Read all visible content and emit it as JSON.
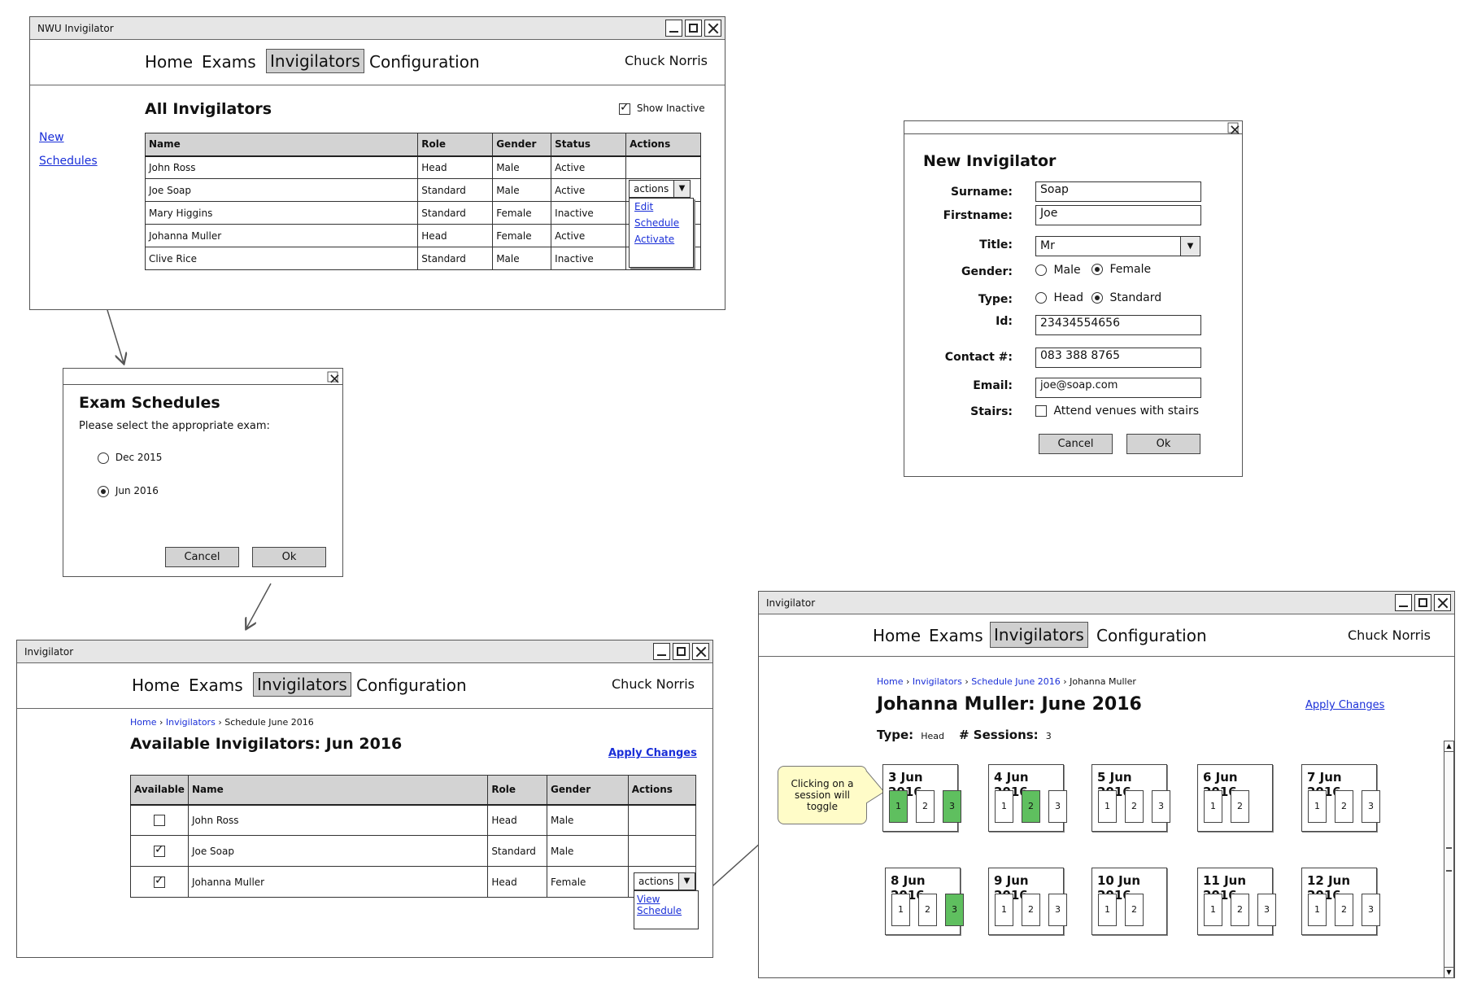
{
  "colors": {
    "link": "#1a2fd8",
    "active_session": "#5fbf5f",
    "header_bg": "#d3d3d3",
    "note_bg": "#fffcc8"
  },
  "nav": {
    "home": "Home",
    "exams": "Exams",
    "invigilators": "Invigilators",
    "configuration": "Configuration",
    "user": "Chuck Norris"
  },
  "w1": {
    "title": "NWU Invigilator",
    "heading": "All Invigilators",
    "show_inactive": "Show Inactive",
    "sidebar": [
      "New",
      "Schedules"
    ],
    "columns": [
      "Name",
      "Role",
      "Gender",
      "Status",
      "Actions"
    ],
    "rows": [
      [
        "John Ross",
        "Head",
        "Male",
        "Active"
      ],
      [
        "Joe Soap",
        "Standard",
        "Male",
        "Active"
      ],
      [
        "Mary Higgins",
        "Standard",
        "Female",
        "Inactive"
      ],
      [
        "Johanna Muller",
        "Head",
        "Female",
        "Active"
      ],
      [
        "Clive Rice",
        "Standard",
        "Male",
        "Inactive"
      ]
    ],
    "actions_label": "actions",
    "menu": [
      "Edit",
      "Schedule",
      "Activate"
    ]
  },
  "w2": {
    "heading": "Exam Schedules",
    "prompt": "Please select the appropriate exam:",
    "options": [
      "Dec 2015",
      "Jun 2016"
    ],
    "selected": "Jun 2016",
    "cancel": "Cancel",
    "ok": "Ok"
  },
  "w3": {
    "heading": "New Invigilator",
    "labels": {
      "surname": "Surname:",
      "firstname": "Firstname:",
      "title": "Title:",
      "gender": "Gender:",
      "type": "Type:",
      "id": "Id:",
      "contact": "Contact #:",
      "email": "Email:",
      "stairs": "Stairs:"
    },
    "values": {
      "surname": "Soap",
      "firstname": "Joe",
      "title": "Mr",
      "id": "23434554656",
      "contact": "083 388 8765",
      "email": "joe@soap.com"
    },
    "gender_options": [
      "Male",
      "Female"
    ],
    "gender_selected": "Female",
    "type_options": [
      "Head",
      "Standard"
    ],
    "type_selected": "Standard",
    "stairs_label": "Attend venues with stairs",
    "stairs_checked": false,
    "cancel": "Cancel",
    "ok": "Ok"
  },
  "w4": {
    "title": "Invigilator",
    "breadcrumb": [
      "Home",
      "Invigilators",
      "Schedule June 2016"
    ],
    "heading": "Available Invigilators: Jun 2016",
    "apply": "Apply Changes",
    "columns": [
      "Available",
      "Name",
      "Role",
      "Gender",
      "Actions"
    ],
    "rows": [
      {
        "available": false,
        "name": "John Ross",
        "role": "Head",
        "gender": "Male"
      },
      {
        "available": true,
        "name": "Joe Soap",
        "role": "Standard",
        "gender": "Male"
      },
      {
        "available": true,
        "name": "Johanna Muller",
        "role": "Head",
        "gender": "Female"
      }
    ],
    "actions_label": "actions",
    "menu": [
      "View Schedule"
    ]
  },
  "w5": {
    "title": "Invigilator",
    "breadcrumb": [
      "Home",
      "Invigilators",
      "Schedule June 2016",
      "Johanna Muller"
    ],
    "heading": "Johanna Muller: June 2016",
    "apply": "Apply Changes",
    "type_label": "Type:",
    "type_value": "Head",
    "sessions_label": "# Sessions:",
    "sessions_value": "3",
    "note": "Clicking on a session will toggle",
    "days": [
      {
        "date": "3 Jun 2016",
        "sessions": [
          "1",
          "2",
          "3"
        ],
        "active": [
          true,
          false,
          true
        ]
      },
      {
        "date": "4 Jun 2016",
        "sessions": [
          "1",
          "2",
          "3"
        ],
        "active": [
          false,
          true,
          false
        ]
      },
      {
        "date": "5 Jun 2016",
        "sessions": [
          "1",
          "2",
          "3"
        ],
        "active": [
          false,
          false,
          false
        ]
      },
      {
        "date": "6 Jun 2016",
        "sessions": [
          "1",
          "2"
        ],
        "active": [
          false,
          false
        ]
      },
      {
        "date": "7 Jun 2016",
        "sessions": [
          "1",
          "2",
          "3"
        ],
        "active": [
          false,
          false,
          false
        ]
      },
      {
        "date": "8 Jun 2016",
        "sessions": [
          "1",
          "2",
          "3"
        ],
        "active": [
          false,
          false,
          true
        ]
      },
      {
        "date": "9 Jun 2016",
        "sessions": [
          "1",
          "2",
          "3"
        ],
        "active": [
          false,
          false,
          false
        ]
      },
      {
        "date": "10 Jun 2016",
        "sessions": [
          "1",
          "2"
        ],
        "active": [
          false,
          false
        ]
      },
      {
        "date": "11 Jun 2016",
        "sessions": [
          "1",
          "2",
          "3"
        ],
        "active": [
          false,
          false,
          false
        ]
      },
      {
        "date": "12 Jun 2016",
        "sessions": [
          "1",
          "2",
          "3"
        ],
        "active": [
          false,
          false,
          false
        ]
      }
    ]
  }
}
